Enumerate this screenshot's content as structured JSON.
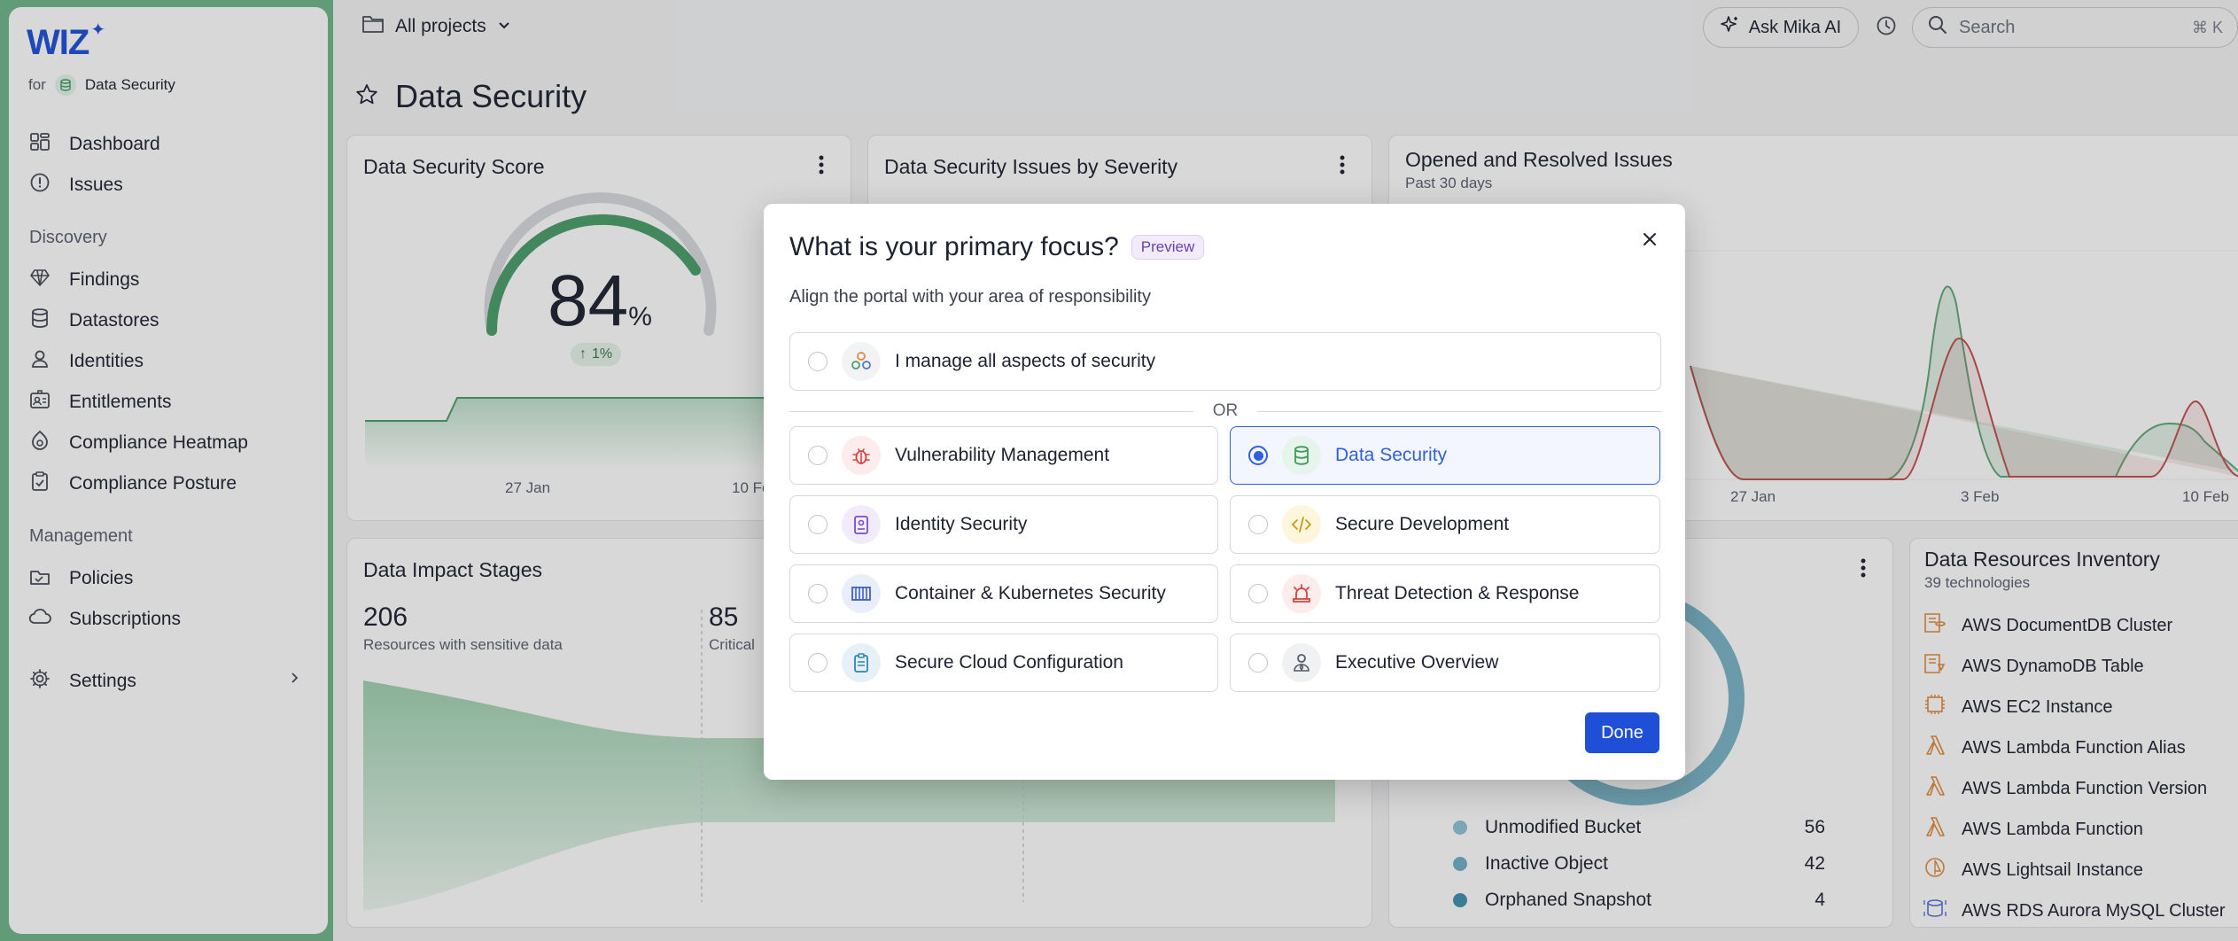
{
  "brand": {
    "logo": "WIZ",
    "for_label": "for",
    "project": "Data Security"
  },
  "sidebar": {
    "items_top": [
      {
        "label": "Dashboard",
        "icon": "dashboard-icon"
      },
      {
        "label": "Issues",
        "icon": "issues-icon"
      }
    ],
    "section_discovery": "Discovery",
    "discovery": [
      {
        "label": "Findings",
        "icon": "diamond-icon"
      },
      {
        "label": "Datastores",
        "icon": "database-icon"
      },
      {
        "label": "Identities",
        "icon": "user-icon"
      },
      {
        "label": "Entitlements",
        "icon": "id-card-icon"
      },
      {
        "label": "Compliance Heatmap",
        "icon": "heatmap-icon"
      },
      {
        "label": "Compliance Posture",
        "icon": "clipboard-check-icon"
      }
    ],
    "section_management": "Management",
    "management": [
      {
        "label": "Policies",
        "icon": "policy-icon"
      },
      {
        "label": "Subscriptions",
        "icon": "cloud-icon"
      }
    ],
    "settings": "Settings"
  },
  "topbar": {
    "project_selector": "All projects",
    "ask_ai": "Ask Mika AI",
    "search_placeholder": "Search",
    "search_shortcut": "⌘ K"
  },
  "page": {
    "title": "Data Security"
  },
  "cards": {
    "score": {
      "title": "Data Security Score",
      "value": "84",
      "unit": "%",
      "delta": "1%",
      "x_ticks": [
        "27 Jan",
        "10 Fe"
      ]
    },
    "severity": {
      "title": "Data Security Issues by Severity"
    },
    "opened_resolved": {
      "title": "Opened and Resolved Issues",
      "subtitle": "Past 30 days",
      "x_ticks": [
        "27 Jan",
        "3 Feb",
        "10 Feb"
      ]
    },
    "impact": {
      "title": "Data Impact Stages",
      "stat1_value": "206",
      "stat1_label": "Resources with sensitive data",
      "stat2_value": "85",
      "stat2_label": "Critical"
    },
    "bucket_legend": [
      {
        "label": "Unmodified Bucket",
        "value": "56",
        "color": "#8fc3d6"
      },
      {
        "label": "Inactive Object",
        "value": "42",
        "color": "#6fb0c9"
      },
      {
        "label": "Orphaned Snapshot",
        "value": "4",
        "color": "#3e8fae"
      }
    ],
    "inventory": {
      "title": "Data Resources Inventory",
      "subtitle": "39 technologies",
      "items": [
        "AWS DocumentDB Cluster",
        "AWS DynamoDB Table",
        "AWS EC2 Instance",
        "AWS Lambda Function Alias",
        "AWS Lambda Function Version",
        "AWS Lambda Function",
        "AWS Lightsail Instance",
        "AWS RDS Aurora MySQL Cluster"
      ]
    }
  },
  "modal": {
    "title": "What is your primary focus?",
    "badge": "Preview",
    "subtitle": "Align the portal with your area of responsibility",
    "all_option": "I manage all aspects of security",
    "or_label": "OR",
    "options": [
      {
        "label": "Vulnerability Management",
        "icon": "bug-icon",
        "selected": false
      },
      {
        "label": "Data Security",
        "icon": "database-icon",
        "selected": true
      },
      {
        "label": "Identity Security",
        "icon": "badge-icon",
        "selected": false
      },
      {
        "label": "Secure Development",
        "icon": "code-icon",
        "selected": false
      },
      {
        "label": "Container & Kubernetes Security",
        "icon": "container-icon",
        "selected": false
      },
      {
        "label": "Threat Detection & Response",
        "icon": "siren-icon",
        "selected": false
      },
      {
        "label": "Secure Cloud Configuration",
        "icon": "clipboard-icon",
        "selected": false
      },
      {
        "label": "Executive Overview",
        "icon": "executive-icon",
        "selected": false
      }
    ],
    "done_label": "Done"
  }
}
